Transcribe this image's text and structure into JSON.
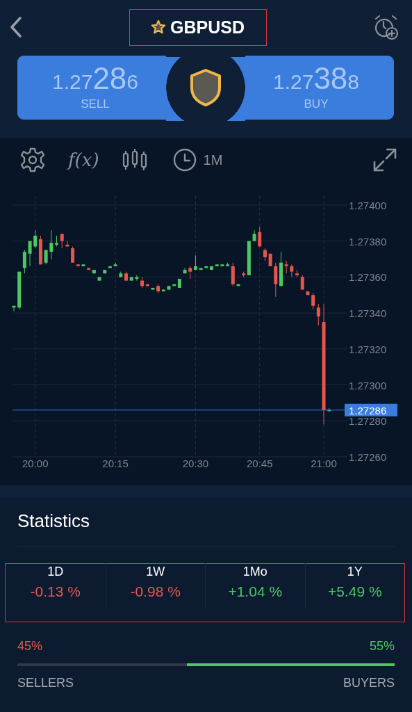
{
  "header": {
    "title": "GBPUSD",
    "highlighted": true
  },
  "quote": {
    "sell": {
      "lead": "1.27",
      "pips": "28",
      "tail": "6",
      "label": "SELL"
    },
    "buy": {
      "lead": "1.27",
      "pips": "38",
      "tail": "8",
      "label": "BUY"
    }
  },
  "toolbar": {
    "indicator_label": "f(x)",
    "timeframe": "1M"
  },
  "chart": {
    "chart_data": {
      "type": "candlestick",
      "ylim": [
        1.2726,
        1.274
      ],
      "grid": true,
      "categories": [
        null,
        null,
        null,
        null,
        "20:00",
        null,
        null,
        null,
        null,
        null,
        null,
        null,
        null,
        null,
        null,
        null,
        null,
        null,
        null,
        "20:15",
        null,
        null,
        null,
        null,
        null,
        null,
        null,
        null,
        null,
        null,
        null,
        null,
        null,
        null,
        "20:30",
        null,
        null,
        null,
        null,
        null,
        null,
        null,
        null,
        null,
        null,
        null,
        "20:45",
        null,
        null,
        null,
        null,
        null,
        null,
        null,
        null,
        null,
        null,
        null,
        "21:00",
        null
      ],
      "yticks": [
        {
          "value": 1.274,
          "label": "1.27400"
        },
        {
          "value": 1.2738,
          "label": "1.27380"
        },
        {
          "value": 1.2736,
          "label": "1.27360"
        },
        {
          "value": 1.2734,
          "label": "1.27340"
        },
        {
          "value": 1.2732,
          "label": "1.27320"
        },
        {
          "value": 1.273,
          "label": "1.27300"
        },
        {
          "value": 1.2728,
          "label": "1.27280"
        },
        {
          "value": 1.2726,
          "label": "1.27260"
        }
      ],
      "ohlc": [
        [
          1.27343,
          1.27344,
          1.27341,
          1.27344
        ],
        [
          1.27343,
          1.27363,
          1.27342,
          1.27363
        ],
        [
          1.27365,
          1.27375,
          1.27362,
          1.27374
        ],
        [
          1.27373,
          1.2738,
          1.27366,
          1.2738
        ],
        [
          1.27377,
          1.27386,
          1.27376,
          1.27383
        ],
        [
          1.27381,
          1.27383,
          1.27367,
          1.27367
        ],
        [
          1.27368,
          1.27375,
          1.27367,
          1.27375
        ],
        [
          1.27374,
          1.27386,
          1.2737,
          1.27379
        ],
        [
          1.27378,
          1.27383,
          1.27377,
          1.27379
        ],
        [
          1.27384,
          1.27384,
          1.27376,
          1.2738
        ],
        [
          1.27378,
          1.2738,
          1.27377,
          1.27377
        ],
        [
          1.27376,
          1.27377,
          1.27368,
          1.27368
        ],
        [
          1.27367,
          1.27367,
          1.27366,
          1.27366
        ],
        [
          1.27366,
          1.27367,
          1.27366,
          1.27367
        ],
        [
          1.27365,
          1.27365,
          1.27364,
          1.27364
        ],
        [
          1.27362,
          1.27364,
          1.27362,
          1.27364
        ],
        [
          1.27358,
          1.2736,
          1.27358,
          1.2736
        ],
        [
          1.27362,
          1.27364,
          1.27362,
          1.27364
        ],
        [
          1.27365,
          1.27366,
          1.27365,
          1.27366
        ],
        [
          1.27366,
          1.27368,
          1.27366,
          1.27367
        ],
        [
          1.2736,
          1.27363,
          1.2736,
          1.27362
        ],
        [
          1.27362,
          1.27363,
          1.27358,
          1.27358
        ],
        [
          1.27358,
          1.2736,
          1.27358,
          1.2736
        ],
        [
          1.27359,
          1.27361,
          1.27358,
          1.2736
        ],
        [
          1.27358,
          1.2736,
          1.27354,
          1.27355
        ],
        [
          1.27356,
          1.27356,
          1.27355,
          1.27355
        ],
        [
          1.27353,
          1.27354,
          1.27353,
          1.27354
        ],
        [
          1.27355,
          1.27356,
          1.27351,
          1.27352
        ],
        [
          1.27352,
          1.27353,
          1.27352,
          1.27353
        ],
        [
          1.27353,
          1.27355,
          1.27353,
          1.27355
        ],
        [
          1.27355,
          1.27356,
          1.27355,
          1.27356
        ],
        [
          1.27354,
          1.27359,
          1.27354,
          1.27359
        ],
        [
          1.27362,
          1.27365,
          1.27362,
          1.27364
        ],
        [
          1.27365,
          1.27366,
          1.27359,
          1.27363
        ],
        [
          1.27364,
          1.27372,
          1.27364,
          1.27366
        ],
        [
          1.27364,
          1.27365,
          1.27364,
          1.27365
        ],
        [
          1.27365,
          1.27366,
          1.27365,
          1.27366
        ],
        [
          1.27364,
          1.27366,
          1.27364,
          1.27366
        ],
        [
          1.27366,
          1.27367,
          1.27366,
          1.27367
        ],
        [
          1.27366,
          1.27367,
          1.27366,
          1.27367
        ],
        [
          1.27366,
          1.27368,
          1.27366,
          1.27367
        ],
        [
          1.27366,
          1.27368,
          1.27355,
          1.27356
        ],
        [
          1.27355,
          1.27356,
          1.27355,
          1.27356
        ],
        [
          1.27362,
          1.27363,
          1.2736,
          1.27361
        ],
        [
          1.27361,
          1.2738,
          1.27361,
          1.2738
        ],
        [
          1.2738,
          1.27386,
          1.2738,
          1.27384
        ],
        [
          1.27385,
          1.27388,
          1.27377,
          1.27377
        ],
        [
          1.27375,
          1.27376,
          1.27369,
          1.27371
        ],
        [
          1.27373,
          1.27373,
          1.27366,
          1.27366
        ],
        [
          1.27366,
          1.27368,
          1.27349,
          1.27356
        ],
        [
          1.27355,
          1.27374,
          1.27355,
          1.27368
        ],
        [
          1.27367,
          1.27369,
          1.27362,
          1.27366
        ],
        [
          1.27366,
          1.27367,
          1.2736,
          1.27363
        ],
        [
          1.27362,
          1.27364,
          1.2736,
          1.27361
        ],
        [
          1.2736,
          1.27361,
          1.27353,
          1.27353
        ],
        [
          1.27352,
          1.27352,
          1.2735,
          1.2735
        ],
        [
          1.2735,
          1.27351,
          1.27342,
          1.27344
        ],
        [
          1.27343,
          1.27345,
          1.27333,
          1.27338
        ],
        [
          1.27335,
          1.27345,
          1.27278,
          1.27286
        ],
        [
          1.27286,
          1.27287,
          1.27285,
          1.27286
        ]
      ],
      "ref_lines": [
        {
          "axis": "y",
          "value": 1.27286,
          "label": "1.27286"
        }
      ]
    }
  },
  "statistics": {
    "title": "Statistics",
    "highlighted": true,
    "periods": [
      {
        "label": "1D",
        "change": "-0.13 %",
        "color": "#e8554d"
      },
      {
        "label": "1W",
        "change": "-0.98 %",
        "color": "#e8554d"
      },
      {
        "label": "1Mo",
        "change": "+1.04 %",
        "color": "#4cc763"
      },
      {
        "label": "1Y",
        "change": "+5.49 %",
        "color": "#4cc763"
      }
    ]
  },
  "sentiment": {
    "sellers_share": "45%",
    "buyers_share": "55%",
    "sellers_label": "SELLERS",
    "buyers_label": "BUYERS",
    "level": 0.55
  }
}
